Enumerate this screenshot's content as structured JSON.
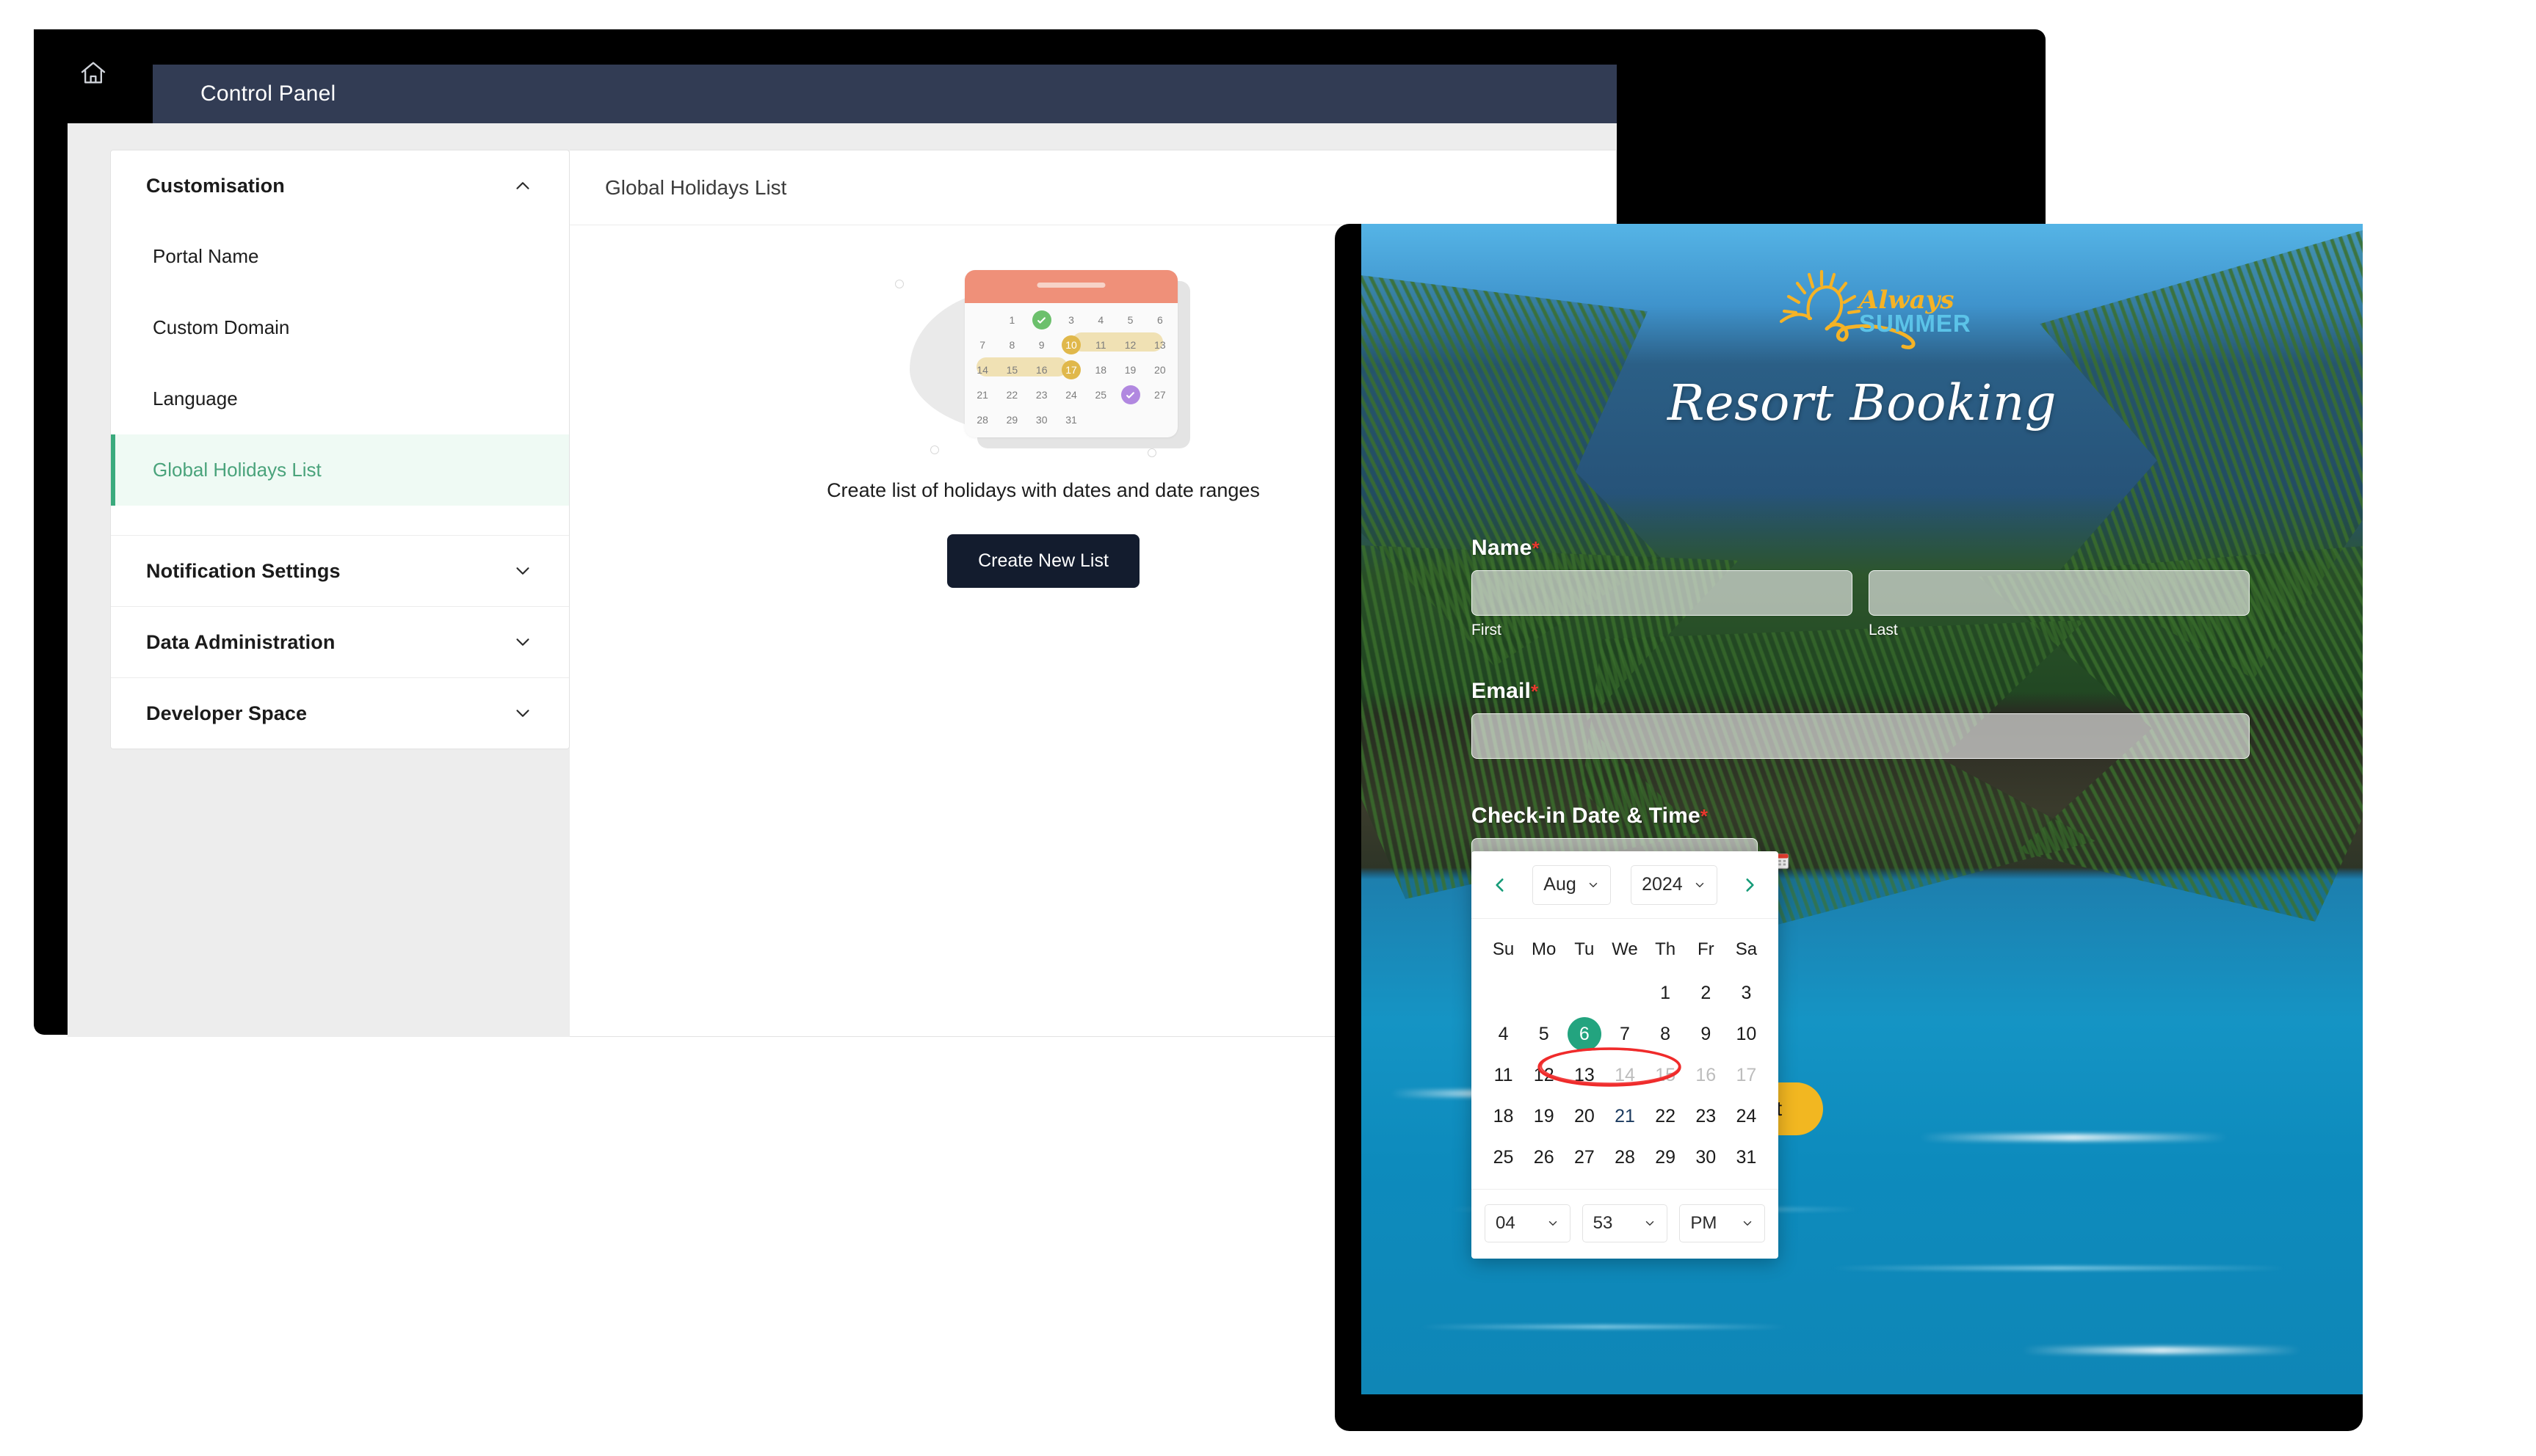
{
  "control_panel": {
    "home_icon": "home-icon",
    "title": "Control Panel",
    "sidebar": {
      "sections": [
        {
          "label": "Customisation",
          "expanded": true,
          "chevron": "chevron-up-icon",
          "items": [
            {
              "label": "Portal Name",
              "active": false
            },
            {
              "label": "Custom Domain",
              "active": false
            },
            {
              "label": "Language",
              "active": false
            },
            {
              "label": "Global Holidays List",
              "active": true
            }
          ]
        },
        {
          "label": "Notification Settings",
          "expanded": false,
          "chevron": "chevron-down-icon",
          "items": []
        },
        {
          "label": "Data Administration",
          "expanded": false,
          "chevron": "chevron-down-icon",
          "items": []
        },
        {
          "label": "Developer Space",
          "expanded": false,
          "chevron": "chevron-down-icon",
          "items": []
        }
      ]
    },
    "main": {
      "header_title": "Global Holidays List",
      "empty_state": {
        "caption": "Create list of holidays with dates and date ranges",
        "button_label": "Create New List",
        "illustration": {
          "name": "calendar-illustration",
          "days": [
            "",
            "1",
            "2",
            "3",
            "4",
            "5",
            "6",
            "7",
            "8",
            "9",
            "10",
            "11",
            "12",
            "13",
            "14",
            "15",
            "16",
            "17",
            "18",
            "19",
            "20",
            "21",
            "22",
            "23",
            "24",
            "25",
            "26",
            "27",
            "28",
            "29",
            "30",
            "31",
            "",
            "",
            ""
          ],
          "green_check_day": "2",
          "purple_check_day": "26",
          "range_start_a": "10",
          "range_end_a": "13",
          "range_start_b": "14",
          "range_end_b": "17"
        }
      }
    }
  },
  "booking_form": {
    "brand": {
      "word_always": "Always",
      "word_summer": "SUMMER",
      "sun_icon": "sun-icon"
    },
    "title": "Resort Booking",
    "fields": {
      "name": {
        "label": "Name",
        "required_mark": "*",
        "first": {
          "value": "",
          "placeholder": "",
          "sub_label": "First"
        },
        "last": {
          "value": "",
          "placeholder": "",
          "sub_label": "Last"
        }
      },
      "email": {
        "label": "Email",
        "required_mark": "*",
        "value": "",
        "placeholder": ""
      },
      "checkin": {
        "label": "Check-in Date & Time",
        "required_mark": "*",
        "value": "",
        "placeholder": "",
        "calendar_icon": "calendar-icon"
      }
    },
    "submit_label": "Submit",
    "accent_yellow": "#f2b721"
  },
  "datepicker": {
    "prev_icon": "chevron-left-icon",
    "next_icon": "chevron-right-icon",
    "month": "Aug",
    "year": "2024",
    "month_chevron": "chevron-down-icon",
    "year_chevron": "chevron-down-icon",
    "day_names": [
      "Su",
      "Mo",
      "Tu",
      "We",
      "Th",
      "Fr",
      "Sa"
    ],
    "weeks": [
      [
        {
          "d": "",
          "state": "empty"
        },
        {
          "d": "",
          "state": "empty"
        },
        {
          "d": "",
          "state": "empty"
        },
        {
          "d": "",
          "state": "empty"
        },
        {
          "d": "1",
          "state": "normal"
        },
        {
          "d": "2",
          "state": "normal"
        },
        {
          "d": "3",
          "state": "normal"
        }
      ],
      [
        {
          "d": "4",
          "state": "normal"
        },
        {
          "d": "5",
          "state": "normal"
        },
        {
          "d": "6",
          "state": "selected"
        },
        {
          "d": "7",
          "state": "normal"
        },
        {
          "d": "8",
          "state": "normal"
        },
        {
          "d": "9",
          "state": "normal"
        },
        {
          "d": "10",
          "state": "normal"
        }
      ],
      [
        {
          "d": "11",
          "state": "normal"
        },
        {
          "d": "12",
          "state": "normal"
        },
        {
          "d": "13",
          "state": "normal"
        },
        {
          "d": "14",
          "state": "disabled"
        },
        {
          "d": "15",
          "state": "disabled"
        },
        {
          "d": "16",
          "state": "disabled"
        },
        {
          "d": "17",
          "state": "disabled"
        }
      ],
      [
        {
          "d": "18",
          "state": "normal"
        },
        {
          "d": "19",
          "state": "normal"
        },
        {
          "d": "20",
          "state": "normal"
        },
        {
          "d": "21",
          "state": "today"
        },
        {
          "d": "22",
          "state": "normal"
        },
        {
          "d": "23",
          "state": "normal"
        },
        {
          "d": "24",
          "state": "normal"
        }
      ],
      [
        {
          "d": "25",
          "state": "normal"
        },
        {
          "d": "26",
          "state": "normal"
        },
        {
          "d": "27",
          "state": "normal"
        },
        {
          "d": "28",
          "state": "normal"
        },
        {
          "d": "29",
          "state": "normal"
        },
        {
          "d": "30",
          "state": "normal"
        },
        {
          "d": "31",
          "state": "normal"
        }
      ]
    ],
    "time": {
      "hour": "04",
      "minute": "53",
      "meridiem": "PM",
      "chevron": "chevron-down-icon"
    },
    "selected_color": "#23a47f",
    "annotation": {
      "name": "red-ellipse-annotation",
      "color": "#ef2b2b",
      "covers": "14-17"
    }
  }
}
